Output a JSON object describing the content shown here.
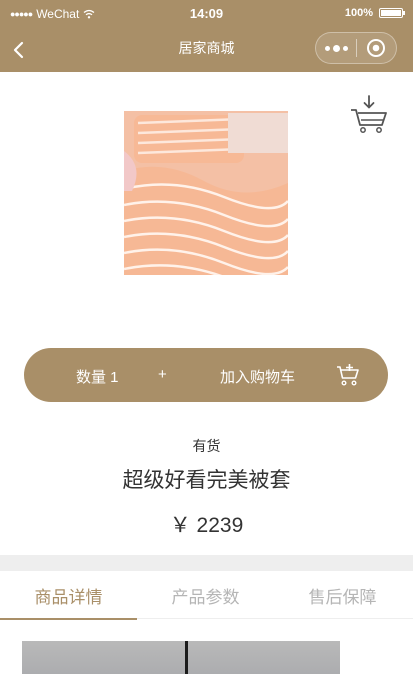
{
  "status_bar": {
    "carrier": "WeChat",
    "time": "14:09",
    "battery": "100%"
  },
  "nav": {
    "title": "居家商城"
  },
  "product": {
    "stock_status": "有货",
    "name": "超级好看完美被套",
    "price": "￥ 2239"
  },
  "actions": {
    "quantity_label": "数量 1",
    "increment_symbol": "+",
    "add_to_cart_label": "加入购物车"
  },
  "tabs": [
    {
      "label": "商品详情",
      "active": true
    },
    {
      "label": "产品参数",
      "active": false
    },
    {
      "label": "售后保障",
      "active": false
    }
  ],
  "colors": {
    "brand": "#a98f68",
    "muted_tab": "#b5b5b5",
    "text": "#333333"
  }
}
